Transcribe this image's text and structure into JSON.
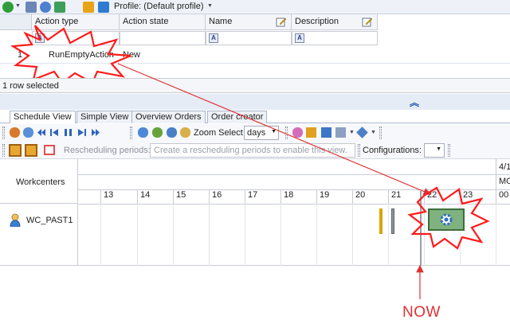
{
  "toolbar": {
    "profile_label": "Profile: (Default profile)"
  },
  "grid": {
    "columns": [
      {
        "label": "Action type"
      },
      {
        "label": "Action state"
      },
      {
        "label": "Name"
      },
      {
        "label": "Description"
      }
    ],
    "filter_icon": "A",
    "rows": [
      {
        "index": "1",
        "action_type": "RunEmptyAction",
        "action_state": "New"
      }
    ],
    "status": "1 row selected"
  },
  "tabs": [
    {
      "label": "Schedule View",
      "active": true
    },
    {
      "label": "Simple View"
    },
    {
      "label": "Overview Orders"
    },
    {
      "label": "Order creator"
    }
  ],
  "view_toolbar": {
    "zoom_label": "Zoom Select",
    "zoom_value": "days",
    "rescheduling_label": "Rescheduling periods:",
    "rescheduling_placeholder": "Create a rescheduling periods to enable this view.",
    "configurations_label": "Configurations:"
  },
  "gantt": {
    "workcenters_header": "Workcenters",
    "month_label": "4/1",
    "weekday_label": "MO",
    "days": [
      "13",
      "14",
      "15",
      "16",
      "17",
      "18",
      "19",
      "20",
      "21",
      "22",
      "23",
      "00"
    ],
    "workcenters": [
      {
        "name": "WC_PAST1"
      }
    ]
  },
  "annotations": {
    "now_label": "NOW"
  },
  "colors": {
    "highlight_star": "#ff1a1a",
    "arrow": "#e03030",
    "bar_yellow": "#d9a400",
    "bar_gray": "#8e9499",
    "task_green": "#7fb27f"
  }
}
